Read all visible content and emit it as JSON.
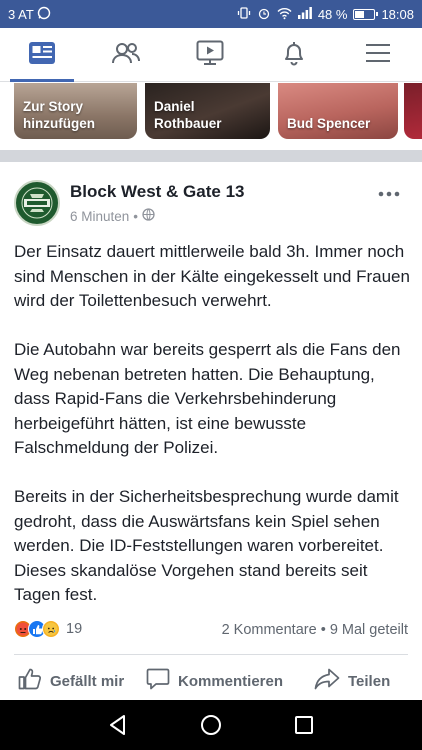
{
  "status_bar": {
    "carrier": "3 AT",
    "battery": "48 %",
    "time": "18:08",
    "battery_level": 0.48
  },
  "tabs": [
    {
      "name": "news-feed",
      "icon": "news-feed-icon",
      "active": true
    },
    {
      "name": "friends",
      "icon": "friends-icon",
      "active": false
    },
    {
      "name": "watch",
      "icon": "video-icon",
      "active": false
    },
    {
      "name": "notifications",
      "icon": "bell-icon",
      "active": false
    },
    {
      "name": "menu",
      "icon": "hamburger-menu-icon",
      "active": false
    }
  ],
  "stories": [
    {
      "label_line1": "Zur Story",
      "label_line2": "hinzufügen"
    },
    {
      "label_line1": "Daniel",
      "label_line2": "Rothbauer"
    },
    {
      "label_line1": "Bud Spencer",
      "label_line2": ""
    }
  ],
  "post": {
    "author": "Block West & Gate 13",
    "time": "6 Minuten",
    "separator": "•",
    "paragraphs": [
      "Der Einsatz dauert mittlerweile bald 3h. Immer noch sind Menschen in der Kälte eingekesselt und Frauen wird der Toilettenbesuch verwehrt.",
      "Die Autobahn war bereits gesperrt als die Fans den Weg nebenan betreten hatten. Die Behauptung, dass Rapid-Fans die Verkehrsbehinderung herbeigeführt hätten, ist eine bewusste Falschmeldung der Polizei.",
      "Bereits in der Sicherheitsbesprechung wurde damit gedroht, dass die Auswärtsfans kein Spiel sehen werden. Die ID-Feststellungen waren vorbereitet. Dieses skandalöse Vorgehen stand bereits seit Tagen fest."
    ],
    "reaction_count": "19",
    "comments": "2 Kommentare",
    "dot": "•",
    "shares": "9 Mal geteilt",
    "actions": {
      "like": "Gefällt mir",
      "comment": "Kommentieren",
      "share": "Teilen"
    }
  },
  "colors": {
    "brand": "#3b5998",
    "accent": "#4267b2",
    "text": "#1d2129",
    "secondary": "#606770"
  }
}
